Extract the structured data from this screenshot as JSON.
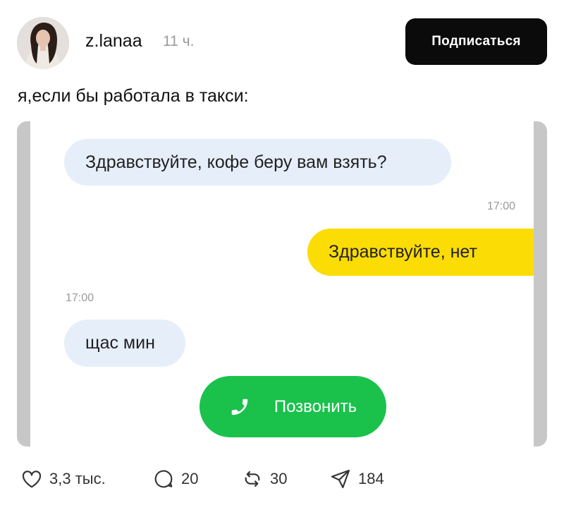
{
  "post": {
    "username": "z.lanaa",
    "time": "11 ч.",
    "follow_label": "Подписаться",
    "text": "я,если бы работала в такси:"
  },
  "chat": {
    "message_1": "Здравствуйте, кофе беру вам взять?",
    "timestamp_1": "17:00",
    "message_2": "Здравствуйте, нет",
    "timestamp_2": "17:00",
    "message_3": "щас мин",
    "call_label": "Позвонить",
    "colors": {
      "incoming": "#e6eefa",
      "outgoing": "#fbdc05",
      "call": "#1ac24c"
    }
  },
  "actions": {
    "likes": "3,3 тыс.",
    "replies": "20",
    "reposts": "30",
    "shares": "184"
  },
  "icons": [
    "avatar-photo",
    "phone-icon",
    "heart-icon",
    "comment-icon",
    "repost-icon",
    "send-icon"
  ]
}
